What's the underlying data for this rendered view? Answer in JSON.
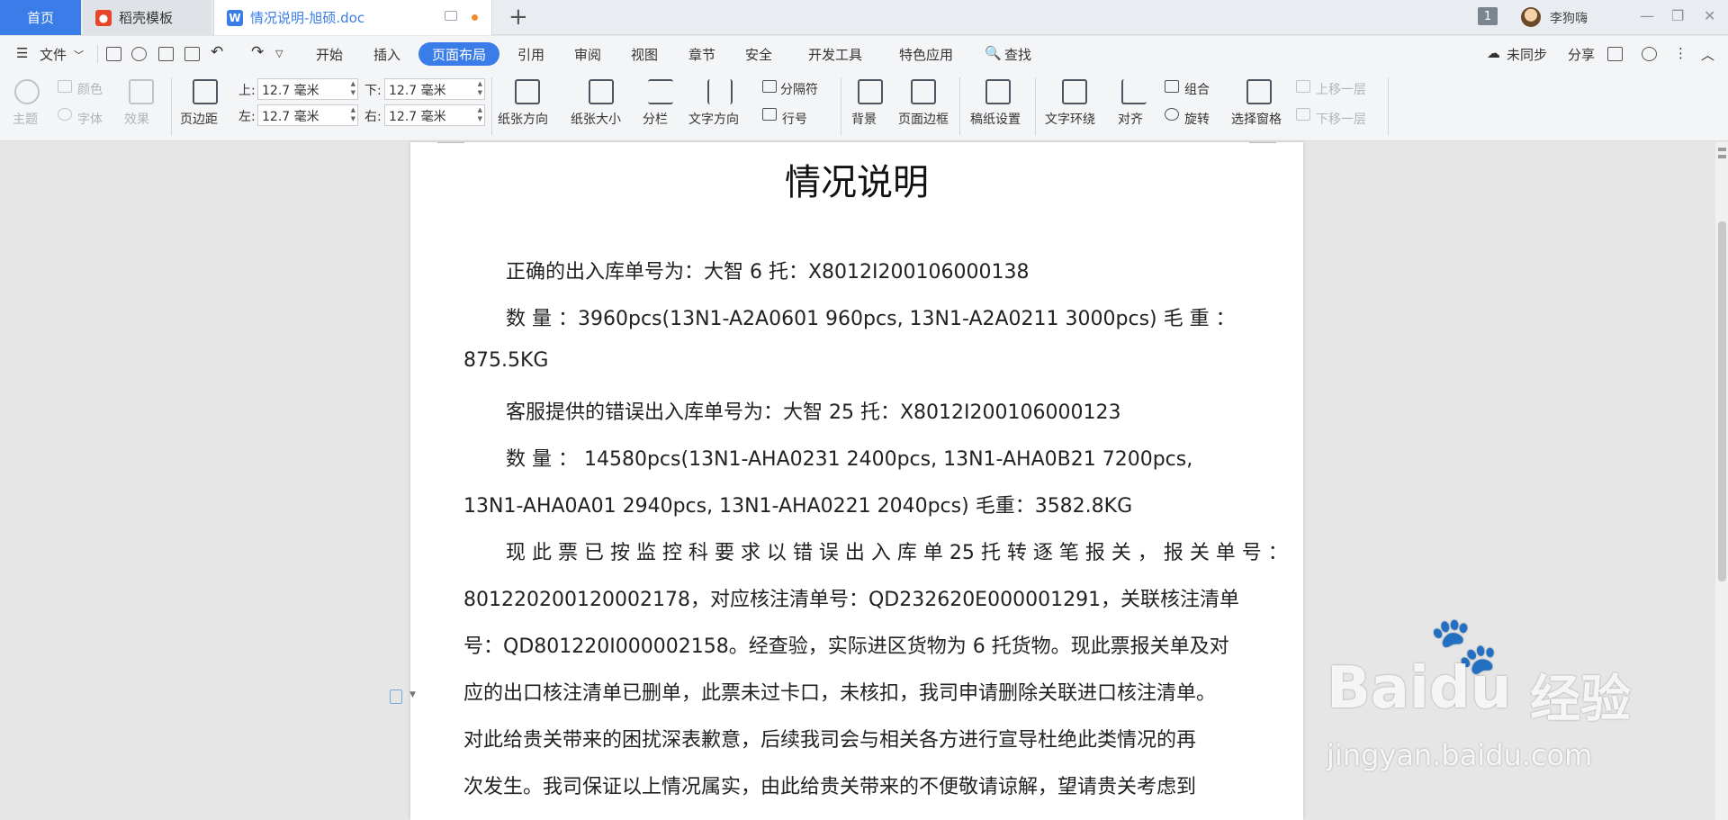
{
  "tabs": {
    "home": "首页",
    "daoke": "稻壳模板",
    "doc": "情况说明-旭硕.doc",
    "add": "+"
  },
  "user": {
    "badge": "1",
    "name": "李狗嗨"
  },
  "menu": {
    "file": "文件",
    "items": [
      "开始",
      "插入",
      "页面布局",
      "引用",
      "审阅",
      "视图",
      "章节",
      "安全",
      "开发工具",
      "特色应用"
    ],
    "active": "页面布局",
    "search": "查找",
    "sync": "未同步",
    "share": "分享"
  },
  "ribbon": {
    "theme": "主题",
    "color": "颜色",
    "font": "字体",
    "effect": "效果",
    "margins": "页边距",
    "top_label": "上:",
    "top_value": "12.7 毫米",
    "bottom_label": "下:",
    "bottom_value": "12.7 毫米",
    "left_label": "左:",
    "left_value": "12.7 毫米",
    "right_label": "右:",
    "right_value": "12.7 毫米",
    "orientation": "纸张方向",
    "size": "纸张大小",
    "columns": "分栏",
    "text_direction": "文字方向",
    "breaks": "分隔符",
    "line_numbers": "行号",
    "background": "背景",
    "page_border": "页面边框",
    "manuscript": "稿纸设置",
    "wrap_text": "文字环绕",
    "align": "对齐",
    "group": "组合",
    "rotate": "旋转",
    "selection_pane": "选择窗格",
    "bring_forward": "上移一层",
    "send_backward": "下移一层"
  },
  "document": {
    "title": "情况说明",
    "lines": [
      "正确的出入库单号为：大智 6 托：X8012I200106000138",
      "数 量 ：3960pcs(13N1-A2A0601 960pcs, 13N1-A2A0211 3000pcs)    毛 重 ：",
      "875.5KG",
      "客服提供的错误出入库单号为：大智 25 托：X8012I200106000123",
      "数   量   ：   14580pcs(13N1-AHA0231   2400pcs,   13N1-AHA0B21   7200pcs,",
      "13N1-AHA0A01 2940pcs, 13N1-AHA0221 2040pcs)      毛重：3582.8KG",
      "现 此 票 已 按 监 控 科 要 求 以 错 误 出 入 库 单  25  托 转 逐 笔 报 关 ， 报 关 单 号 ：",
      "801220200120002178，对应核注清单号：QD232620E000001291，关联核注清单",
      "号：QD801220I000002158。经查验，实际进区货物为 6 托货物。现此票报关单及对",
      "应的出口核注清单已删单，此票未过卡口，未核扣，我司申请删除关联进口核注清单。",
      "对此给贵关带来的困扰深表歉意，后续我司会与相关各方进行宣导杜绝此类情况的再",
      "次发生。我司保证以上情况属实，由此给贵关带来的不便敬请谅解，望请贵关考虑到"
    ]
  },
  "watermark": {
    "brand_en": "Baidu",
    "brand_cn": "经验",
    "url": "jingyan.baidu.com"
  },
  "colors": {
    "accent": "#3b7de8",
    "modified_dot": "#f08c2c"
  }
}
